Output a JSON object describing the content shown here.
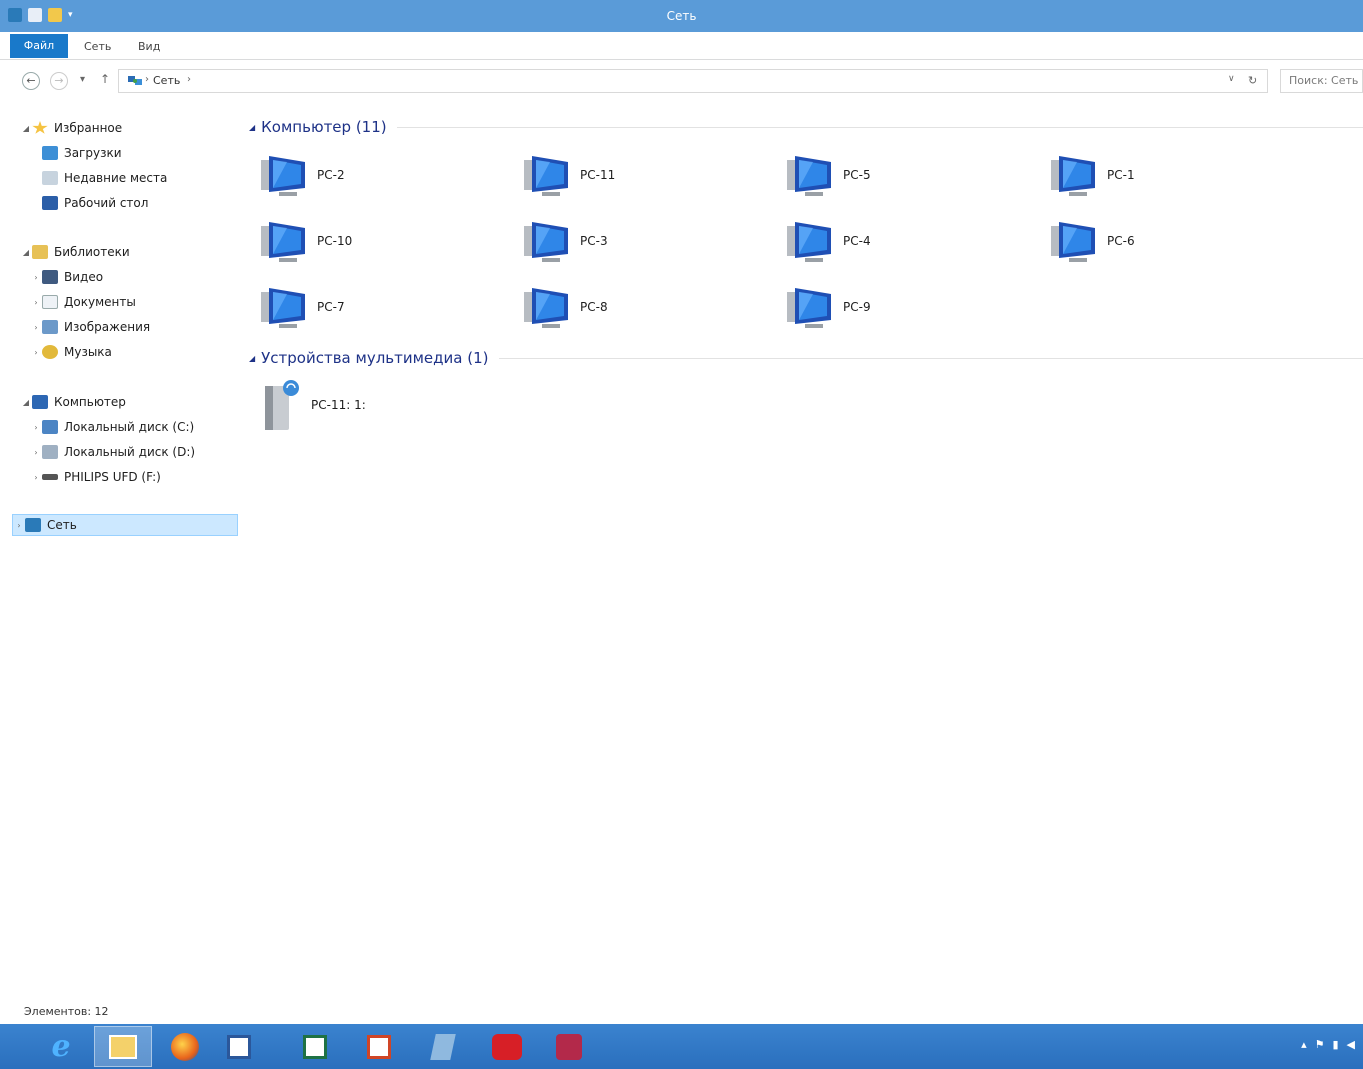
{
  "window": {
    "title": "Сеть"
  },
  "ribbon": {
    "tabs": [
      "Файл",
      "Сеть",
      "Вид"
    ]
  },
  "address": {
    "path": "Сеть",
    "search_placeholder": "Поиск: Сеть"
  },
  "nav": {
    "favorites": {
      "label": "Избранное",
      "items": [
        "Загрузки",
        "Недавние места",
        "Рабочий стол"
      ]
    },
    "libraries": {
      "label": "Библиотеки",
      "items": [
        "Видео",
        "Документы",
        "Изображения",
        "Музыка"
      ]
    },
    "computer": {
      "label": "Компьютер",
      "items": [
        "Локальный диск (C:)",
        "Локальный диск (D:)",
        "PHILIPS UFD (F:)"
      ]
    },
    "network": {
      "label": "Сеть"
    }
  },
  "groups": {
    "computers": {
      "title": "Компьютер (11)",
      "items": [
        "PC-2",
        "PC-11",
        "PC-5",
        "PC-1",
        "PC-10",
        "PC-3",
        "PC-4",
        "PC-6",
        "PC-7",
        "PC-8",
        "PC-9"
      ]
    },
    "media": {
      "title": "Устройства мультимедиа (1)",
      "items": [
        "PC-11: 1:"
      ]
    }
  },
  "status": {
    "items_count": "Элементов: 12"
  },
  "colors": {
    "accent": "#1979ca",
    "titlebar": "#5a9bd8",
    "group_title": "#1e3287",
    "taskbar": "#2a6fbd"
  },
  "taskbar": {
    "apps": [
      "internet-explorer-icon",
      "file-explorer-icon",
      "firefox-icon",
      "word-icon",
      "excel-icon",
      "powerpoint-icon",
      "app-icon",
      "red-app-icon",
      "pen-app-icon"
    ]
  }
}
